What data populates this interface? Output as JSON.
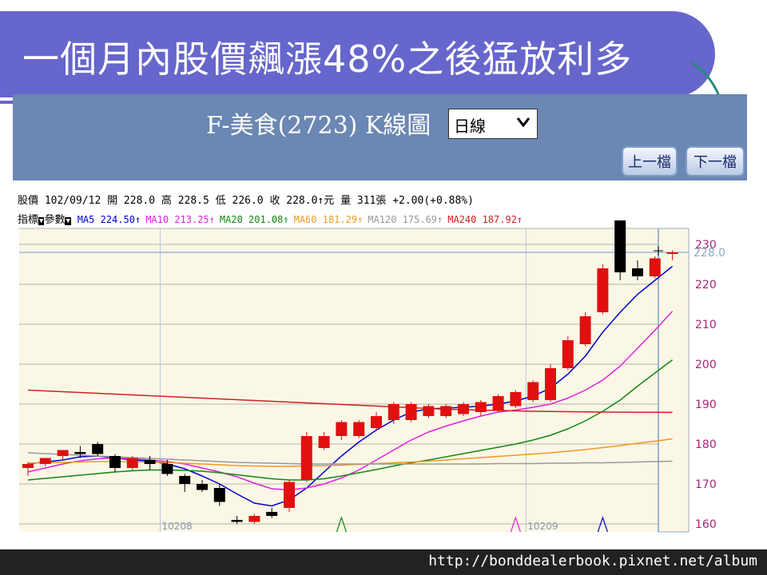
{
  "slide_title": "一個月內股價飆漲48%之後猛放利多",
  "footer_url": "http://bonddealerbook.pixnet.net/album",
  "panel": {
    "title": "F-美食(2723) K線圖",
    "period": "日線",
    "prev_button": "上一檔",
    "next_button": "下一檔"
  },
  "info": {
    "price_line": "股價  102/09/12 開 228.0 高 228.5 低 226.0 收 228.0↑元 量 311張 +2.00(+0.88%)",
    "indicator_label": "指標",
    "params_label": "參數",
    "ma": [
      {
        "label": "MA5 224.50↑",
        "color": "#0000cc"
      },
      {
        "label": "MA10 213.25↑",
        "color": "#dd22dd"
      },
      {
        "label": "MA20 201.08↑",
        "color": "#118811"
      },
      {
        "label": "MA60 181.29↑",
        "color": "#ee9922"
      },
      {
        "label": "MA120 175.69↑",
        "color": "#999999"
      },
      {
        "label": "MA240 187.92↑",
        "color": "#cc2222"
      }
    ]
  },
  "chart_data": {
    "type": "candlestick",
    "ylim": [
      158,
      234
    ],
    "y_ticks": [
      160,
      170,
      180,
      190,
      200,
      210,
      220,
      230
    ],
    "current_price_label": "228.0",
    "month_labels": [
      {
        "index": 8,
        "text": "10208"
      },
      {
        "index": 29,
        "text": "10209"
      }
    ],
    "candles": [
      {
        "o": 174,
        "h": 175.5,
        "l": 172,
        "c": 175
      },
      {
        "o": 175,
        "h": 176.5,
        "l": 174.5,
        "c": 176.5
      },
      {
        "o": 177,
        "h": 178.5,
        "l": 176,
        "c": 178.5
      },
      {
        "o": 178,
        "h": 179.5,
        "l": 176.5,
        "c": 177.5
      },
      {
        "o": 180,
        "h": 180.5,
        "l": 177,
        "c": 177.5
      },
      {
        "o": 177,
        "h": 177.5,
        "l": 173,
        "c": 174
      },
      {
        "o": 174,
        "h": 177,
        "l": 173.5,
        "c": 176.5
      },
      {
        "o": 176,
        "h": 177,
        "l": 173.5,
        "c": 175
      },
      {
        "o": 175,
        "h": 176,
        "l": 172,
        "c": 172.5
      },
      {
        "o": 172,
        "h": 172.5,
        "l": 168,
        "c": 170
      },
      {
        "o": 170,
        "h": 171,
        "l": 168,
        "c": 168.5
      },
      {
        "o": 169,
        "h": 170,
        "l": 164.5,
        "c": 165.5
      },
      {
        "o": 161,
        "h": 162,
        "l": 160,
        "c": 160.5
      },
      {
        "o": 160.5,
        "h": 162.5,
        "l": 160,
        "c": 162
      },
      {
        "o": 163,
        "h": 164,
        "l": 161.5,
        "c": 162
      },
      {
        "o": 164,
        "h": 171,
        "l": 163,
        "c": 170.5
      },
      {
        "o": 171,
        "h": 183,
        "l": 170.5,
        "c": 182
      },
      {
        "o": 179,
        "h": 183,
        "l": 178.5,
        "c": 182
      },
      {
        "o": 182,
        "h": 186,
        "l": 181,
        "c": 185.5
      },
      {
        "o": 182,
        "h": 186,
        "l": 181.5,
        "c": 185.5
      },
      {
        "o": 184,
        "h": 188,
        "l": 183.5,
        "c": 187
      },
      {
        "o": 186,
        "h": 190.5,
        "l": 185,
        "c": 190
      },
      {
        "o": 186,
        "h": 190.5,
        "l": 185.5,
        "c": 190
      },
      {
        "o": 187,
        "h": 190,
        "l": 186.5,
        "c": 189.5
      },
      {
        "o": 187,
        "h": 190,
        "l": 186.5,
        "c": 189.5
      },
      {
        "o": 187.5,
        "h": 190.5,
        "l": 187,
        "c": 190
      },
      {
        "o": 188,
        "h": 191,
        "l": 187,
        "c": 190.5
      },
      {
        "o": 188.5,
        "h": 192.5,
        "l": 188,
        "c": 192
      },
      {
        "o": 189.5,
        "h": 193.5,
        "l": 189,
        "c": 193
      },
      {
        "o": 191,
        "h": 196,
        "l": 190.5,
        "c": 195.5
      },
      {
        "o": 191,
        "h": 200,
        "l": 190.5,
        "c": 199
      },
      {
        "o": 199,
        "h": 207,
        "l": 198.5,
        "c": 206
      },
      {
        "o": 205,
        "h": 213,
        "l": 204.5,
        "c": 212
      },
      {
        "o": 213,
        "h": 225,
        "l": 212.5,
        "c": 224
      },
      {
        "o": 236,
        "h": 236,
        "l": 221,
        "c": 223
      },
      {
        "o": 224,
        "h": 226,
        "l": 221,
        "c": 222
      },
      {
        "o": 222,
        "h": 227,
        "l": 221.5,
        "c": 226.5
      },
      {
        "o": 228,
        "h": 228.5,
        "l": 226,
        "c": 228
      }
    ],
    "ma_lines": {
      "MA5": [
        175,
        175.5,
        176,
        176.8,
        177,
        176.5,
        176,
        175.8,
        175,
        173.8,
        172,
        170,
        167.5,
        165.2,
        164.5,
        166,
        169,
        173,
        177,
        180.5,
        183.5,
        186,
        188,
        188.8,
        189,
        189.2,
        189.5,
        190,
        190.8,
        192,
        194,
        197.5,
        202,
        208,
        213,
        217.5,
        221,
        224.5
      ],
      "MA10": [
        173,
        174,
        175,
        175.8,
        176.3,
        176.5,
        176.3,
        176,
        175.6,
        175,
        174,
        173,
        171.8,
        170.2,
        168.8,
        168.5,
        169,
        170,
        171.5,
        173.5,
        176,
        178.5,
        181,
        183,
        184.5,
        185.8,
        187,
        188,
        188.5,
        189.2,
        190,
        191.5,
        193.5,
        196,
        199.5,
        204,
        208.5,
        213.25
      ],
      "MA20": [
        171,
        171.4,
        171.8,
        172.2,
        172.6,
        173,
        173.3,
        173.5,
        173.5,
        173.4,
        173.2,
        172.8,
        172.3,
        171.8,
        171.3,
        171,
        171,
        171.3,
        172,
        172.8,
        173.6,
        174.5,
        175.3,
        176,
        176.8,
        177.6,
        178.4,
        179.2,
        180,
        181,
        182.2,
        183.8,
        185.8,
        188.2,
        191,
        194.5,
        197.8,
        201.08
      ],
      "MA60": [
        175.2,
        175.3,
        175.4,
        175.5,
        175.6,
        175.6,
        175.6,
        175.5,
        175.4,
        175.2,
        175,
        174.8,
        174.6,
        174.5,
        174.4,
        174.4,
        174.5,
        174.6,
        174.7,
        174.9,
        175.1,
        175.3,
        175.5,
        175.7,
        176,
        176.3,
        176.6,
        176.9,
        177.2,
        177.5,
        177.8,
        178.2,
        178.6,
        179.1,
        179.6,
        180.2,
        180.7,
        181.29
      ],
      "MA120": [
        177.8,
        177.6,
        177.4,
        177.2,
        177,
        176.8,
        176.6,
        176.4,
        176.2,
        176,
        175.8,
        175.6,
        175.4,
        175.3,
        175.2,
        175.1,
        175,
        175,
        175,
        175,
        175,
        175,
        175,
        175,
        175,
        175,
        175,
        175.1,
        175.1,
        175.1,
        175.2,
        175.2,
        175.3,
        175.3,
        175.4,
        175.5,
        175.6,
        175.69
      ],
      "MA240": [
        193.5,
        193.3,
        193.1,
        192.9,
        192.7,
        192.5,
        192.3,
        192.1,
        191.9,
        191.7,
        191.5,
        191.3,
        191.1,
        190.9,
        190.7,
        190.5,
        190.3,
        190.1,
        189.9,
        189.7,
        189.5,
        189.3,
        189.1,
        188.9,
        188.7,
        188.6,
        188.5,
        188.4,
        188.3,
        188.2,
        188.15,
        188.1,
        188.05,
        188,
        187.98,
        187.96,
        187.94,
        187.92
      ]
    }
  }
}
